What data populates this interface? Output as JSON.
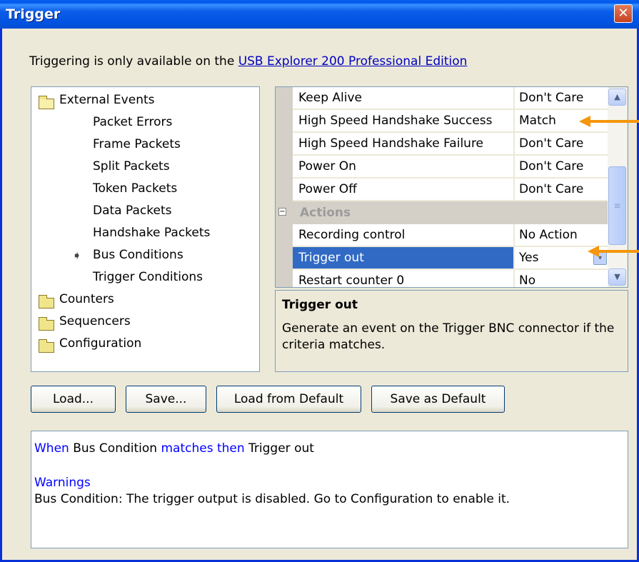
{
  "window": {
    "title": "Trigger",
    "close_glyph": "✕"
  },
  "info": {
    "prefix": "Triggering is only available on the ",
    "link_text": "USB Explorer 200 Professional Edition"
  },
  "tree": {
    "root_open": {
      "label": "External Events",
      "icon": "folder-open-icon"
    },
    "children": [
      "Packet Errors",
      "Frame Packets",
      "Split Packets",
      "Token Packets",
      "Data Packets",
      "Handshake Packets",
      "Bus Conditions",
      "Trigger Conditions"
    ],
    "selected_marker": "➧",
    "folders": [
      "Counters",
      "Sequencers",
      "Configuration"
    ]
  },
  "grid": {
    "rows": [
      {
        "name": "Keep Alive",
        "value": "Don't Care"
      },
      {
        "name": "High Speed Handshake Success",
        "value": "Match"
      },
      {
        "name": "High Speed Handshake Failure",
        "value": "Don't Care"
      },
      {
        "name": "Power On",
        "value": "Don't Care"
      },
      {
        "name": "Power Off",
        "value": "Don't Care"
      }
    ],
    "category": {
      "label": "Actions",
      "toggle": "−"
    },
    "action_rows": [
      {
        "name": "Recording control",
        "value": "No Action"
      },
      {
        "name": "Trigger out",
        "value": "Yes"
      },
      {
        "name": "Restart counter 0",
        "value": "No"
      }
    ],
    "dropdown_glyph": "▾",
    "scroll_up_glyph": "▲",
    "scroll_down_glyph": "▼",
    "thumb_grip": "≡"
  },
  "description": {
    "title": "Trigger out",
    "body": "Generate an event on the Trigger BNC connector if the criteria matches."
  },
  "buttons": {
    "load": "Load...",
    "save": "Save...",
    "load_default": "Load from Default",
    "save_default": "Save as Default"
  },
  "output": {
    "w1": "When",
    "t1": " Bus Condition ",
    "w2": "matches then",
    "t2": " Trigger out",
    "warnings_heading": "Warnings",
    "warning_text": "Bus Condition: The trigger output is disabled. Go to Configuration to enable it."
  },
  "colors": {
    "titlebar": "#0053e0",
    "selection": "#316ac5",
    "keyword_blue": "#0000ff",
    "callout_orange": "#f5960c"
  }
}
